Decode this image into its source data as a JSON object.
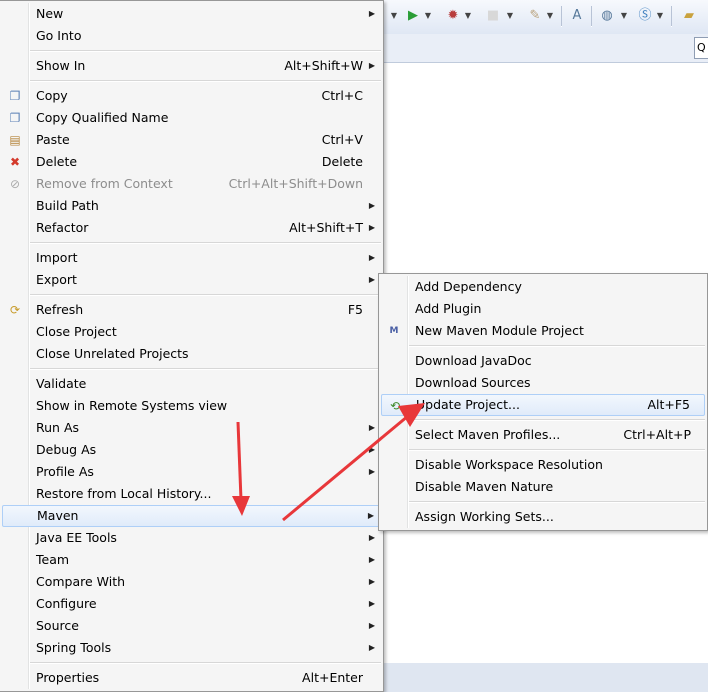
{
  "main_menu": {
    "items": [
      {
        "label": "New",
        "arrow": true
      },
      {
        "label": "Go Into"
      },
      {
        "label": "Show In",
        "shortcut": "Alt+Shift+W",
        "arrow": true
      },
      {
        "label": "Copy",
        "shortcut": "Ctrl+C",
        "icon": "copy-icon"
      },
      {
        "label": "Copy Qualified Name",
        "icon": "copy-qualified-icon"
      },
      {
        "label": "Paste",
        "shortcut": "Ctrl+V",
        "icon": "paste-icon"
      },
      {
        "label": "Delete",
        "shortcut": "Delete",
        "icon": "delete-icon"
      },
      {
        "label": "Remove from Context",
        "shortcut": "Ctrl+Alt+Shift+Down",
        "icon": "remove-context-icon",
        "disabled": true
      },
      {
        "label": "Build Path",
        "arrow": true
      },
      {
        "label": "Refactor",
        "shortcut": "Alt+Shift+T",
        "arrow": true
      },
      {
        "label": "Import",
        "arrow": true
      },
      {
        "label": "Export",
        "arrow": true
      },
      {
        "label": "Refresh",
        "shortcut": "F5",
        "icon": "refresh-icon"
      },
      {
        "label": "Close Project"
      },
      {
        "label": "Close Unrelated Projects"
      },
      {
        "label": "Validate"
      },
      {
        "label": "Show in Remote Systems view"
      },
      {
        "label": "Run As",
        "arrow": true
      },
      {
        "label": "Debug As",
        "arrow": true
      },
      {
        "label": "Profile As",
        "arrow": true
      },
      {
        "label": "Restore from Local History..."
      },
      {
        "label": "Maven",
        "arrow": true,
        "selected": true
      },
      {
        "label": "Java EE Tools",
        "arrow": true
      },
      {
        "label": "Team",
        "arrow": true
      },
      {
        "label": "Compare With",
        "arrow": true
      },
      {
        "label": "Configure",
        "arrow": true
      },
      {
        "label": "Source",
        "arrow": true
      },
      {
        "label": "Spring Tools",
        "arrow": true
      },
      {
        "label": "Properties",
        "shortcut": "Alt+Enter"
      }
    ]
  },
  "maven_submenu": {
    "items": [
      {
        "label": "Add Dependency"
      },
      {
        "label": "Add Plugin"
      },
      {
        "label": "New Maven Module Project",
        "icon": "maven-module-icon"
      },
      {
        "label": "Download JavaDoc"
      },
      {
        "label": "Download Sources"
      },
      {
        "label": "Update Project...",
        "shortcut": "Alt+F5",
        "icon": "update-project-icon",
        "selected": true
      },
      {
        "label": "Select Maven Profiles...",
        "shortcut": "Ctrl+Alt+P"
      },
      {
        "label": "Disable Workspace Resolution"
      },
      {
        "label": "Disable Maven Nature"
      },
      {
        "label": "Assign Working Sets..."
      }
    ]
  },
  "ide": {
    "quick_access_text": "Q"
  },
  "colors": {
    "annotation_arrow": "#e8373a",
    "selection_border": "#aecff7"
  }
}
